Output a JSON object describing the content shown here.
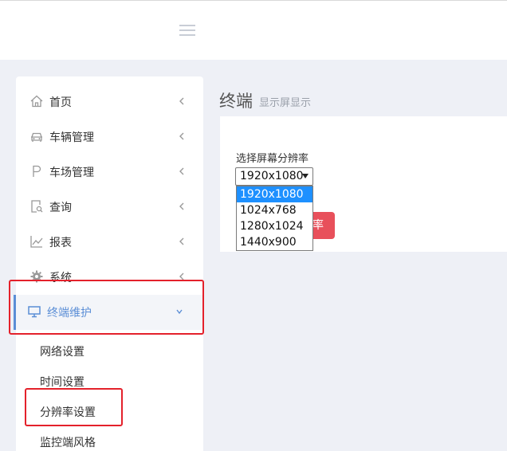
{
  "colors": {
    "accent": "#5b8ed6",
    "highlight": "#e4212b",
    "danger_button": "#e8505b",
    "option_selected": "#1e90ff"
  },
  "sidebar": {
    "items": [
      {
        "label": "首页",
        "icon": "home-icon"
      },
      {
        "label": "车辆管理",
        "icon": "car-icon"
      },
      {
        "label": "车场管理",
        "icon": "parking-icon"
      },
      {
        "label": "查询",
        "icon": "search-document-icon"
      },
      {
        "label": "报表",
        "icon": "line-chart-icon"
      },
      {
        "label": "系统",
        "icon": "gear-icon"
      },
      {
        "label": "终端维护",
        "icon": "monitor-icon"
      }
    ],
    "subitems": [
      "网络设置",
      "时间设置",
      "分辨率设置",
      "监控端风格"
    ]
  },
  "main": {
    "title": "终端",
    "subtitle": "显示屏显示",
    "field_label": "选择屏幕分辨率",
    "select_value": "1920x1080",
    "options": [
      "1920x1080",
      "1024x768",
      "1280x1024",
      "1440x900"
    ],
    "button_partial_label": "率"
  }
}
